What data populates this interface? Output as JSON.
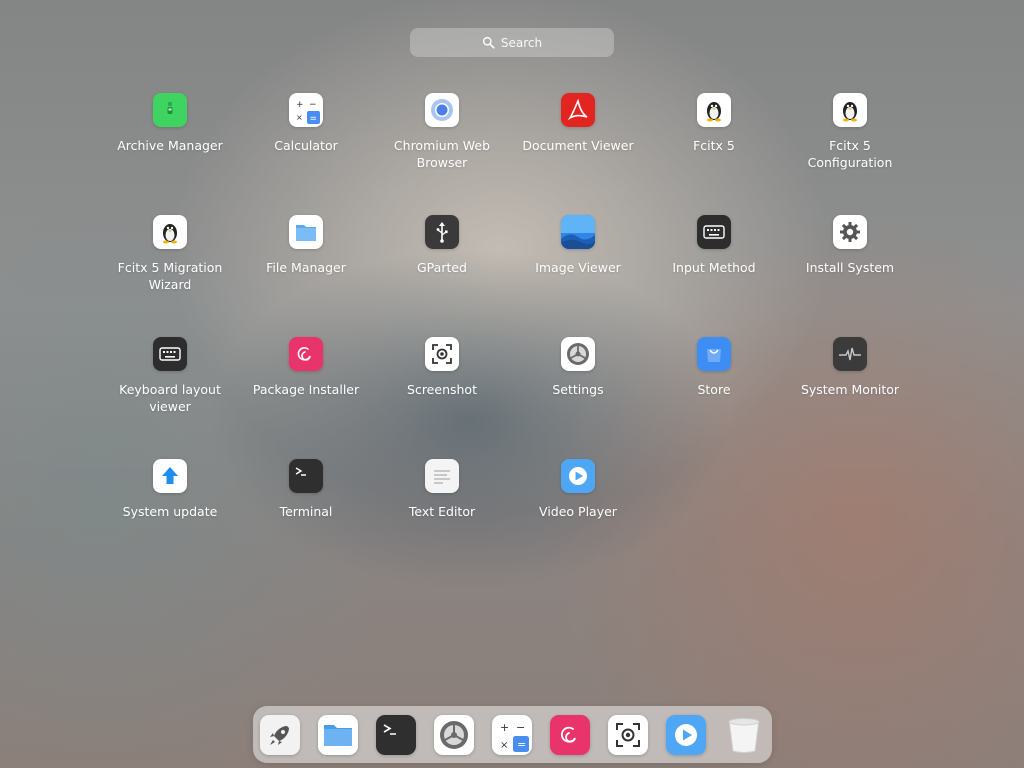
{
  "search": {
    "placeholder": "Search",
    "icon": "search-icon"
  },
  "apps": [
    {
      "label": "Archive Manager",
      "icon": "archive-icon"
    },
    {
      "label": "Calculator",
      "icon": "calculator-icon"
    },
    {
      "label": "Chromium Web Browser",
      "icon": "chromium-icon"
    },
    {
      "label": "Document Viewer",
      "icon": "pdf-icon"
    },
    {
      "label": "Fcitx 5",
      "icon": "penguin-icon"
    },
    {
      "label": "Fcitx 5 Configuration",
      "icon": "penguin-icon"
    },
    {
      "label": "Fcitx 5 Migration Wizard",
      "icon": "penguin-icon"
    },
    {
      "label": "File Manager",
      "icon": "folder-icon"
    },
    {
      "label": "GParted",
      "icon": "usb-icon"
    },
    {
      "label": "Image Viewer",
      "icon": "image-icon"
    },
    {
      "label": "Input Method",
      "icon": "keyboard-icon"
    },
    {
      "label": "Install System",
      "icon": "gear-icon"
    },
    {
      "label": "Keyboard layout viewer",
      "icon": "keyboard-icon"
    },
    {
      "label": "Package Installer",
      "icon": "debian-icon"
    },
    {
      "label": "Screenshot",
      "icon": "screenshot-icon"
    },
    {
      "label": "Settings",
      "icon": "settings-icon"
    },
    {
      "label": "Store",
      "icon": "store-icon"
    },
    {
      "label": "System Monitor",
      "icon": "monitor-icon"
    },
    {
      "label": "System update",
      "icon": "update-icon"
    },
    {
      "label": "Terminal",
      "icon": "terminal-icon"
    },
    {
      "label": "Text Editor",
      "icon": "text-editor-icon"
    },
    {
      "label": "Video Player",
      "icon": "video-icon"
    }
  ],
  "dock": [
    {
      "icon": "launcher-icon"
    },
    {
      "icon": "folder-icon"
    },
    {
      "icon": "terminal-icon"
    },
    {
      "icon": "settings-icon"
    },
    {
      "icon": "calculator-icon"
    },
    {
      "icon": "debian-icon"
    },
    {
      "icon": "screenshot-icon"
    },
    {
      "icon": "video-icon"
    },
    {
      "icon": "trash-icon"
    }
  ],
  "colors": {
    "archive": "#3fd461",
    "calculator": "#4a8df0",
    "pdf": "#e32522",
    "folder": "#5aa9ee",
    "store": "#3e8df5",
    "debian": "#e8336b",
    "video": "#4fa6f5",
    "update": "#1f8ef0"
  }
}
